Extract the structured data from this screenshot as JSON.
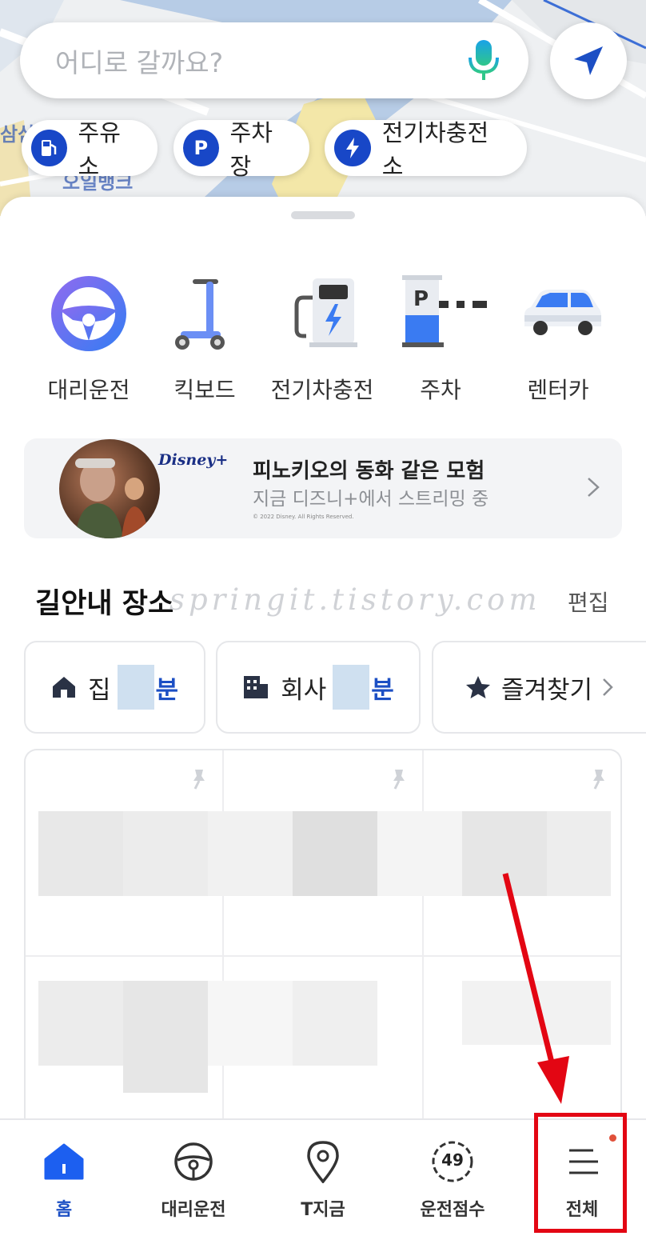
{
  "search": {
    "placeholder": "어디로 갈까요?"
  },
  "map_labels": [
    "삼삼",
    "오일뱅크"
  ],
  "chips": [
    {
      "icon": "gas-station-icon",
      "label": "주유소"
    },
    {
      "icon": "parking-icon",
      "glyph": "P",
      "label": "주차장"
    },
    {
      "icon": "ev-charging-icon",
      "label": "전기차충전소"
    }
  ],
  "services": [
    {
      "icon": "steering-wheel-icon",
      "label": "대리운전"
    },
    {
      "icon": "kickboard-icon",
      "label": "킥보드"
    },
    {
      "icon": "ev-charger-icon",
      "label": "전기차충전"
    },
    {
      "icon": "parking-gate-icon",
      "sign": "P",
      "label": "주차"
    },
    {
      "icon": "rental-car-icon",
      "label": "렌터카"
    }
  ],
  "banner": {
    "logo": "Disney+",
    "title": "피노키오의 동화 같은 모험",
    "subtitle": "지금 디즈니+에서 스트리밍 중",
    "copyright": "© 2022 Disney. All Rights Reserved."
  },
  "places": {
    "title": "길안내 장소",
    "watermark": "springit.tistory.com",
    "edit": "편집",
    "home": {
      "label": "집",
      "minutes": "분"
    },
    "work": {
      "label": "회사",
      "minutes": "분"
    },
    "favorites": {
      "label": "즐겨찾기"
    }
  },
  "nav": [
    {
      "icon": "home-icon",
      "label": "홈",
      "active": true
    },
    {
      "icon": "steering-wheel-icon",
      "label": "대리운전"
    },
    {
      "icon": "location-pin-icon",
      "label": "T지금"
    },
    {
      "icon": "score-gauge-icon",
      "label": "운전점수",
      "badge": "49"
    },
    {
      "icon": "menu-icon",
      "label": "전체"
    }
  ],
  "colors": {
    "accent": "#1c4fc4",
    "highlight": "#e30613"
  }
}
